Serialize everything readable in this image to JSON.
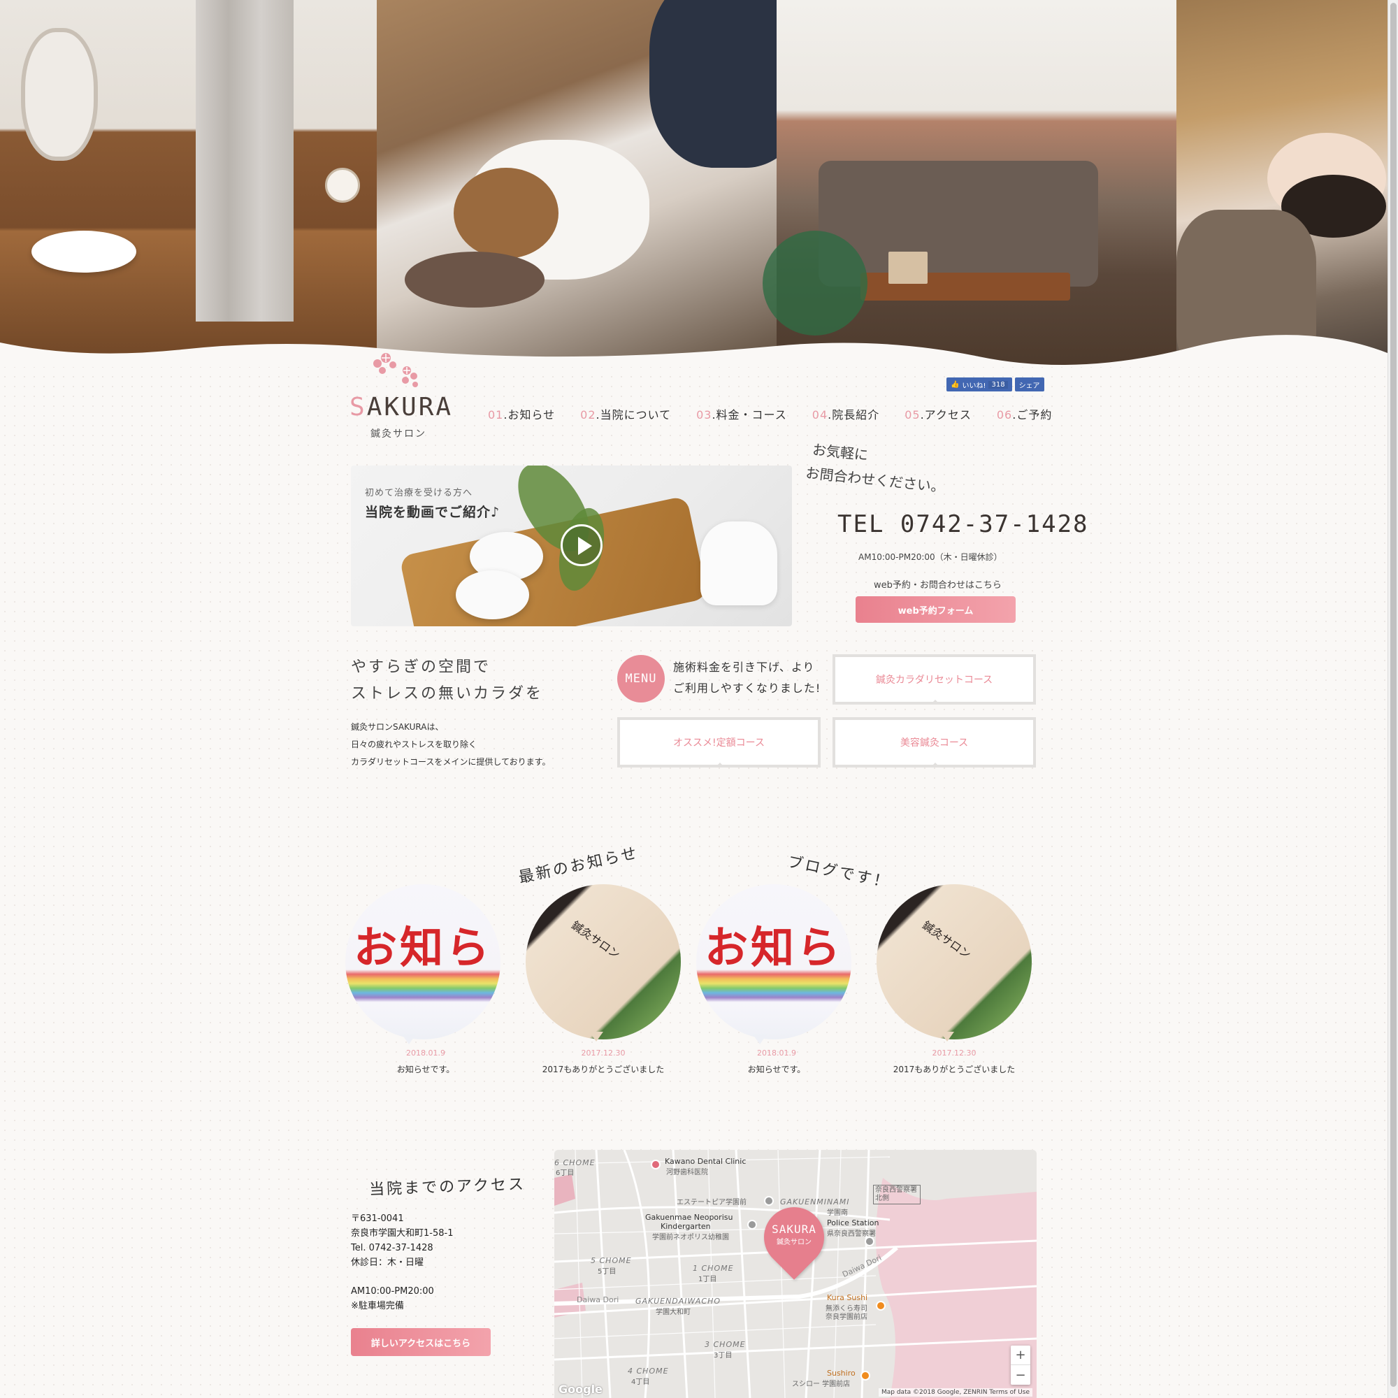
{
  "header": {
    "logo_main_lead": "S",
    "logo_main_rest": "AKURA",
    "logo_sub": "鍼灸サロン",
    "fb_like": "いいね!",
    "fb_count": "318",
    "fb_share": "シェア"
  },
  "nav": [
    {
      "num": "01",
      "label": ".お知らせ"
    },
    {
      "num": "02",
      "label": ".当院について"
    },
    {
      "num": "03",
      "label": ".料金・コース"
    },
    {
      "num": "04",
      "label": ".院長紹介"
    },
    {
      "num": "05",
      "label": ".アクセス"
    },
    {
      "num": "06",
      "label": ".ご予約"
    }
  ],
  "video": {
    "sub": "初めて治療を受ける方へ",
    "title": "当院を動画でご紹介♪"
  },
  "contact": {
    "hand_1": "お気軽に",
    "hand_2": "お問合わせください。",
    "tel": "TEL 0742-37-1428",
    "hours": "AM10:00-PM20:00（木・日曜休診）",
    "web_caption": "web予約・お問合わせはこちら",
    "web_button": "web予約フォーム"
  },
  "intro": {
    "hand_1": "やすらぎの空間で",
    "hand_2": "ストレスの無いカラダを",
    "body_1": "鍼灸サロンSAKURAは、",
    "body_2": "日々の疲れやストレスを取り除く",
    "body_3": "カラダリセットコースをメインに提供しております。"
  },
  "menu": {
    "badge": "MENU",
    "msg_1": "施術料金を引き下げ、より",
    "msg_2": "ご利用しやすくなりました!",
    "courses": [
      "鍼灸カラダリセットコース",
      "オススメ!定額コース",
      "美容鍼灸コース"
    ]
  },
  "news": {
    "label_news": "最新のお知らせ",
    "label_blog": "ブログです！",
    "thumb_notice_text": "お知ら",
    "thumb_blog_text": "鍼灸サロン",
    "items": [
      {
        "date": "2018.01.9",
        "title": "お知らせです。"
      },
      {
        "date": "2017.12.30",
        "title": "2017もありがとうございました"
      },
      {
        "date": "2018.01.9",
        "title": "お知らせです。"
      },
      {
        "date": "2017.12.30",
        "title": "2017もありがとうございました"
      }
    ]
  },
  "access": {
    "hand": "当院までのアクセス",
    "postal": "〒631-0041",
    "address": "奈良市学園大和町1-58-1",
    "tel": "Tel. 0742-37-1428",
    "closed": "休診日：木・日曜",
    "hours": "AM10:00-PM20:00",
    "parking": "※駐車場完備",
    "button": "詳しいアクセスはこちら"
  },
  "map": {
    "pin_main": "SAKURA",
    "pin_sub": "鍼灸サロン",
    "labels": {
      "chome6": "6 CHOME",
      "chome6_jp": "6丁目",
      "kawano": "Kawano Dental Clinic",
      "kawano_jp": "河野歯科医院",
      "esthe": "エステートピア学園前",
      "gakuenminami": "GAKUENMINAMI",
      "gakuenminami_jp": "学園南",
      "police_jp_box": "奈良西警察署北側",
      "neoporisu_1": "Gakuenmae Neoporisu",
      "neoporisu_2": "Kindergarten",
      "neoporisu_jp": "学園前ネオポリス幼稚園",
      "police": "Police Station",
      "police_jp": "県奈良西警察署",
      "chome5": "5 CHOME",
      "chome5_jp": "5丁目",
      "chome1": "1 CHOME",
      "chome1_jp": "1丁目",
      "daiwa_dori_e": "Daiwa Dori",
      "daiwa_dori_w": "Daiwa Dori",
      "gakuendaiwacho": "GAKUENDAIWACHO",
      "gakuendaiwacho_jp": "学園大和町",
      "kura": "Kura Sushi",
      "kura_jp_1": "無添くら寿司",
      "kura_jp_2": "奈良学園前店",
      "chome3": "3 CHOME",
      "chome3_jp": "3丁目",
      "chome4": "4 CHOME",
      "chome4_jp": "4丁目",
      "sushiro": "Sushiro",
      "sushiro_jp": "スシロー 学園前店"
    },
    "zoom_in": "+",
    "zoom_out": "−",
    "google": "Google",
    "attribution": "Map data ©2018 Google, ZENRIN   Terms of Use"
  },
  "colors": {
    "accent_pink": "#e89aa5",
    "button_pink": "#e9818e",
    "logo_dark": "#4a3f3a"
  }
}
